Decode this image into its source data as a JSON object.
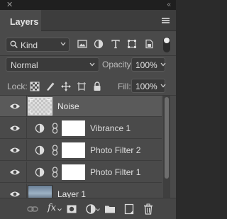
{
  "window": {
    "close_glyph": "✕",
    "collapse_glyph": "‹‹"
  },
  "tab": {
    "label": "Layers",
    "menu_icon": "hamburger-icon"
  },
  "filter": {
    "kind_label": "Kind",
    "icons": [
      "pixel-layer-filter-icon",
      "adjustment-layer-filter-icon",
      "type-layer-filter-icon",
      "shape-layer-filter-icon",
      "smart-object-filter-icon"
    ],
    "toggle_state": "on"
  },
  "blend": {
    "mode": "Normal",
    "opacity_label": "Opacity:",
    "opacity_value": "100%"
  },
  "lock": {
    "label": "Lock:",
    "fill_label": "Fill:",
    "fill_value": "100%",
    "icons": [
      "lock-transparent-pixels-icon",
      "lock-image-pixels-icon",
      "lock-position-icon",
      "lock-artboard-icon",
      "lock-all-icon"
    ]
  },
  "layers": [
    {
      "name": "Noise",
      "type": "pixel",
      "selected": true,
      "visible": true
    },
    {
      "name": "Vibrance 1",
      "type": "adjustment",
      "selected": false,
      "visible": true
    },
    {
      "name": "Photo Filter 2",
      "type": "adjustment",
      "selected": false,
      "visible": true
    },
    {
      "name": "Photo Filter 1",
      "type": "adjustment",
      "selected": false,
      "visible": true
    },
    {
      "name": "Layer 1",
      "type": "pixel",
      "selected": false,
      "visible": true
    }
  ],
  "bottom_bar": {
    "fx_label": "fx",
    "icons": [
      "link-layers-icon",
      "add-layer-style-icon",
      "add-mask-icon",
      "new-adjustment-layer-icon",
      "new-group-icon",
      "new-layer-icon",
      "delete-layer-icon"
    ]
  },
  "colors": {
    "panel": "#4a4a4a",
    "selected_row": "#5a5a5a",
    "tab_bar": "#3d3d3d",
    "field": "#3a3a3a"
  }
}
